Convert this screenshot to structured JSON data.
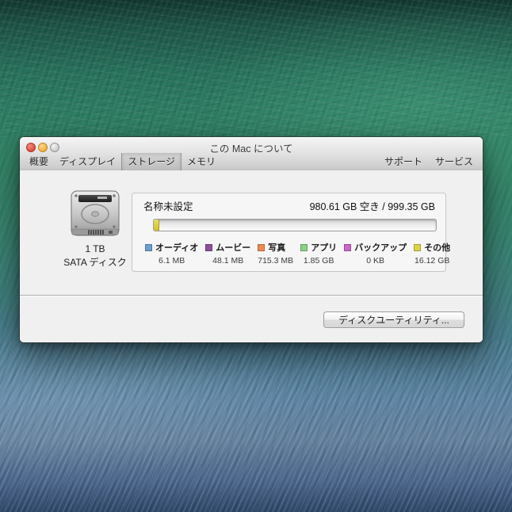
{
  "window": {
    "title": "この Mac について",
    "tabs": [
      {
        "label": "概要",
        "selected": false
      },
      {
        "label": "ディスプレイ",
        "selected": false
      },
      {
        "label": "ストレージ",
        "selected": true
      },
      {
        "label": "メモリ",
        "selected": false
      }
    ],
    "toolbar_right": [
      {
        "label": "サポート"
      },
      {
        "label": "サービス"
      }
    ]
  },
  "disk": {
    "capacity": "1 TB",
    "type": "SATA ディスク",
    "volume_name": "名称未設定",
    "free_summary": "980.61 GB 空き / 999.35 GB",
    "bar": {
      "used_percent": 1.9,
      "used_color_top": "#e9de62",
      "used_color_bottom": "#cfc02e"
    },
    "usage": [
      {
        "label": "オーディオ",
        "size": "6.1 MB",
        "color": "#6a9ecf"
      },
      {
        "label": "ムービー",
        "size": "48.1 MB",
        "color": "#8d4f9c"
      },
      {
        "label": "写真",
        "size": "715.3 MB",
        "color": "#ee8a50"
      },
      {
        "label": "アプリ",
        "size": "1.85 GB",
        "color": "#8cd186"
      },
      {
        "label": "バックアップ",
        "size": "0 KB",
        "color": "#c868c8"
      },
      {
        "label": "その他",
        "size": "16.12 GB",
        "color": "#e0d247"
      }
    ]
  },
  "actions": {
    "disk_utility_label": "ディスクユーティリティ..."
  }
}
